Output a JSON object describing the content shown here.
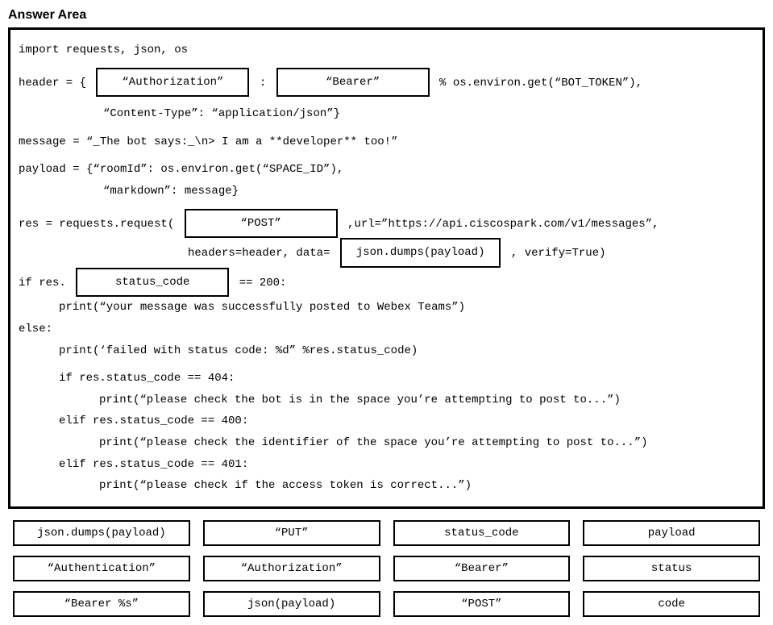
{
  "title": "Answer Area",
  "code": {
    "l1": "import requests, json, os",
    "l2a": "header = {",
    "drop1": "“Authorization”",
    "l2b": " :",
    "drop2": "“Bearer”",
    "l2c": " % os.environ.get(“BOT_TOKEN”),",
    "l3": "“Content-Type”: “application/json”}",
    "l4": "message = “_The bot says:_\\n> I am a **developer** too!”",
    "l5a": "payload = {“roomId”: os.environ.get(“SPACE_ID”),",
    "l5b": "“markdown”: message}",
    "l6a": "res = requests.request(",
    "drop3": "“POST”",
    "l6b": ",url=”https://api.ciscospark.com/v1/messages”,",
    "l7a": "headers=header, data=",
    "drop4": "json.dumps(payload)",
    "l7b": ", verify=True)",
    "l8a": "if res.",
    "drop5": "status_code",
    "l8b": " == 200:",
    "l9": "print(“your message was successfully posted to Webex Teams”)",
    "l10": "else:",
    "l11": "print(‘failed with status code: %d” %res.status_code)",
    "l12": "if res.status_code == 404:",
    "l13": "print(“please check the bot is in the space you’re attempting to post to...”)",
    "l14": "elif res.status_code == 400:",
    "l15": "print(“please check the identifier of the space you’re attempting to post to...”)",
    "l16": "elif res.status_code == 401:",
    "l17": "print(“please check if the access token is correct...”)"
  },
  "options": [
    "json.dumps(payload)",
    "“PUT”",
    "status_code",
    "payload",
    "“Authentication”",
    "“Authorization”",
    "“Bearer”",
    "status",
    "“Bearer %s”",
    "json(payload)",
    "“POST”",
    "code"
  ]
}
